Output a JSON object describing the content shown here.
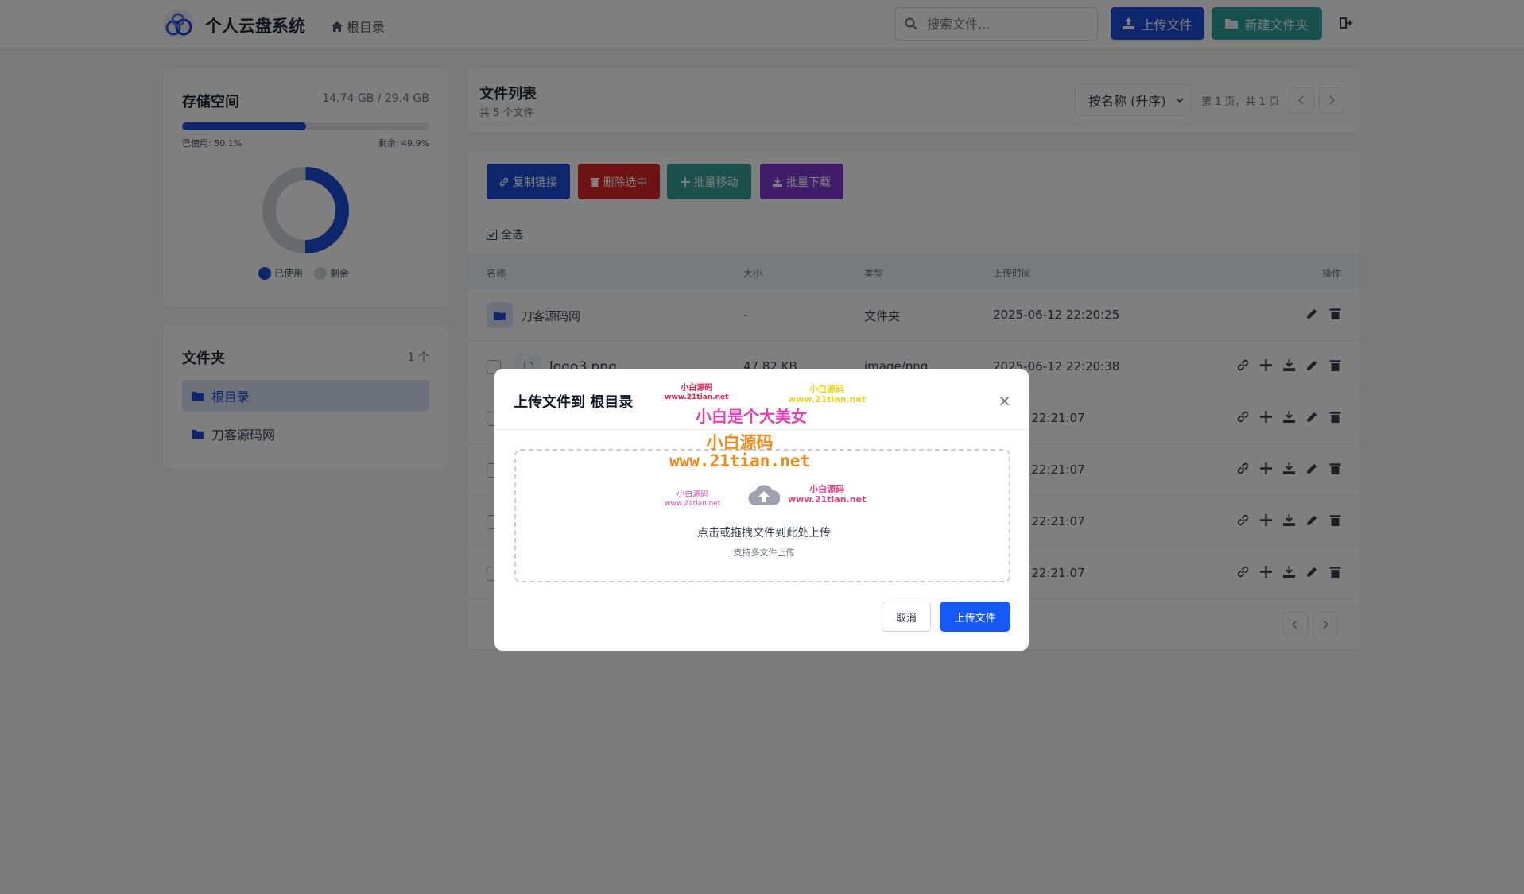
{
  "header": {
    "app_title": "个人云盘系统",
    "breadcrumb": "根目录",
    "search_placeholder": "搜索文件...",
    "upload_label": "上传文件",
    "new_folder_label": "新建文件夹"
  },
  "storage": {
    "title": "存储空间",
    "amount": "14.74 GB / 29.4 GB",
    "used_fraction": 0.501,
    "used_text": "已使用: 50.1%",
    "free_text": "剩余: 49.9%",
    "legend_used": "已使用",
    "legend_free": "剩余",
    "used_color": "#1d4ed8",
    "free_color": "#d1d5db"
  },
  "folders": {
    "title": "文件夹",
    "count": "1 个",
    "items": [
      {
        "label": "根目录",
        "active": true
      },
      {
        "label": "刀客源码网",
        "active": false
      }
    ]
  },
  "list": {
    "title": "文件列表",
    "subtitle": "共 5 个文件",
    "sort_value": "按名称 (升序)",
    "page_info": "第 1 页，共 1 页"
  },
  "bulk": {
    "copy_link": "复制链接",
    "delete_selected": "删除选中",
    "batch_move": "批量移动",
    "batch_download": "批量下载",
    "select_all": "全选"
  },
  "table": {
    "columns": [
      "名称",
      "大小",
      "类型",
      "上传时间",
      "操作"
    ],
    "rows": [
      {
        "name": "刀客源码网",
        "size": "-",
        "type": "文件夹",
        "time": "2025-06-12 22:20:25"
      },
      {
        "name": "logo3.png",
        "size": "47.82 KB",
        "type": "image/png",
        "time": "2025-06-12 22:20:38"
      },
      {
        "name": "",
        "size": "",
        "type": "",
        "time": "06-12 22:21:07"
      },
      {
        "name": "",
        "size": "",
        "type": "",
        "time": "06-12 22:21:07"
      },
      {
        "name": "",
        "size": "",
        "type": "",
        "time": "06-12 22:21:07"
      },
      {
        "name": "",
        "size": "",
        "type": "",
        "time": "06-12 22:21:07"
      }
    ]
  },
  "modal": {
    "title": "上传文件到 根目录",
    "drop_text": "点击或拖拽文件到此处上传",
    "drop_sub": "支持多文件上传",
    "cancel": "取消",
    "submit": "上传文件"
  },
  "watermarks": {
    "w1_line1": "小白源码",
    "w1_line2": "www.21tian.net",
    "w2_line1": "小白源码",
    "w2_line2": "www.21tian.net",
    "w3": "小白是个大美女",
    "w4_line1": "小白源码",
    "w4_line2": "www.21tian.net",
    "w5_line1": "小白源码",
    "w5_line2": "www.21tian.net",
    "w6_line1": "小白源码",
    "w6_line2": "www.21tian.net"
  }
}
